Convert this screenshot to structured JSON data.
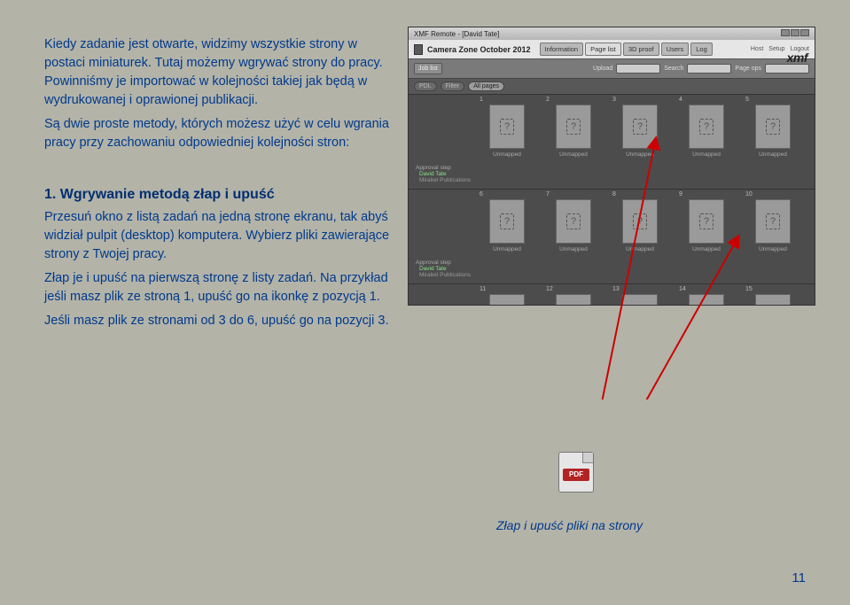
{
  "text": {
    "intro1": "Kiedy zadanie jest otwarte, widzimy wszystkie strony w postaci miniaturek. Tutaj możemy wgrywać strony do pracy. Powinniśmy je importować w kolejności takiej jak będą w wydrukowanej i oprawionej publikacji.",
    "intro2": "Są dwie proste metody, których możesz użyć w celu wgrania pracy przy zachowaniu odpowiedniej kolejności stron:",
    "heading1": "1. Wgrywanie metodą złap i upuść",
    "body1a": "Przesuń okno z listą zadań na jedną stronę ekranu, tak abyś widział pulpit (desktop) komputera. Wybierz pliki zawierające strony z Twojej pracy.",
    "body1b": "Złap je i upuść na pierwszą stronę z listy zadań. Na przykład jeśli masz plik ze stroną 1, upuść go na ikonkę z pozycją 1.",
    "body1c": "Jeśli masz plik ze stronami od 3 do 6, upuść go na pozycji 3.",
    "caption": "Złap i upuść pliki na strony",
    "pageNum": "11"
  },
  "screenshot": {
    "windowTitle": "XMF Remote - [David Tate]",
    "jobTitle": "Camera Zone October 2012",
    "tabs": [
      "Information",
      "Page list",
      "3D proof",
      "Users",
      "Log"
    ],
    "topnav": [
      "Host",
      "Setup",
      "Logout"
    ],
    "logo": "xmf",
    "subbar": {
      "btns": [
        "Job list"
      ],
      "upload": "Upload",
      "search": "Search",
      "pageops": "Page ops"
    },
    "filter": {
      "pill1": "PDL",
      "pill2": "Filter",
      "all": "All pages"
    },
    "rows": [
      {
        "nums": [
          "1",
          "2",
          "3",
          "4",
          "5"
        ],
        "caps": [
          "Unmapped",
          "Unmapped",
          "Unmapped",
          "Unmapped",
          "Unmapped"
        ]
      },
      {
        "nums": [
          "6",
          "7",
          "8",
          "9",
          "10"
        ],
        "caps": [
          "Unmapped",
          "Unmapped",
          "Unmapped",
          "Unmapped",
          "Unmapped"
        ]
      },
      {
        "nums": [
          "11",
          "12",
          "13",
          "14",
          "15"
        ],
        "caps": [
          "",
          "",
          "",
          "",
          ""
        ]
      }
    ],
    "approval": {
      "label": "Approval step",
      "user": "David Tate",
      "org": "Mirabel Publications"
    }
  },
  "pdf": {
    "label": "PDF"
  }
}
